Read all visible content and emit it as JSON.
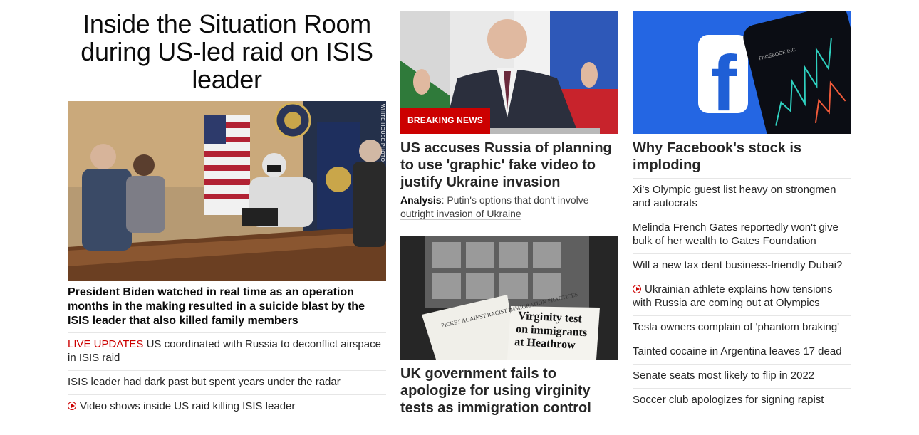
{
  "lead": {
    "headline": "Inside the Situation Room during US-led raid on ISIS leader",
    "image_credit": "WHITE HOUSE PHOTO",
    "summary": "President Biden watched in real time as an operation months in the making resulted in a suicide blast by the ISIS leader that also killed family members",
    "links": [
      {
        "prefix": "LIVE UPDATES",
        "text": "US coordinated with Russia to deconflict airspace in ISIS raid"
      },
      {
        "text": "ISIS leader had dark past but spent years under the radar"
      },
      {
        "icon": "play-icon",
        "text": "Video shows inside US raid killing ISIS leader"
      }
    ]
  },
  "russia_story": {
    "badge": "BREAKING NEWS",
    "title": "US accuses Russia of planning to use 'graphic' fake video to justify Ukraine invasion",
    "analysis_label": "Analysis",
    "analysis_text": ": Putin's options that don't involve outright invasion of Ukraine"
  },
  "uk_story": {
    "clip_left": "PICKET AGAINST RACIST IMMIGRATION PRACTICES",
    "clip_right_line1": "Virginity test",
    "clip_right_line2": "on immigrants",
    "clip_right_line3": "at Heathrow",
    "title": "UK government fails to apologize for using virginity tests as immigration control"
  },
  "facebook_story": {
    "title": "Why Facebook's stock is imploding",
    "logo_letter": "f",
    "phone_label": "FACEBOOK INC",
    "links": [
      {
        "text": "Xi's Olympic guest list heavy on strongmen and autocrats"
      },
      {
        "text": "Melinda French Gates reportedly won't give bulk of her wealth to Gates Foundation"
      },
      {
        "text": "Will a new tax dent business-friendly Dubai?"
      },
      {
        "icon": "play-icon",
        "text": "Ukrainian athlete explains how tensions with Russia are coming out at Olympics"
      },
      {
        "text": "Tesla owners complain of 'phantom braking'"
      },
      {
        "text": "Tainted cocaine in Argentina leaves 17 dead"
      },
      {
        "text": "Senate seats most likely to flip in 2022"
      },
      {
        "text": "Soccer club apologizes for signing rapist"
      }
    ]
  },
  "colors": {
    "accent": "#cc0000",
    "facebook_blue": "#1877f2"
  }
}
